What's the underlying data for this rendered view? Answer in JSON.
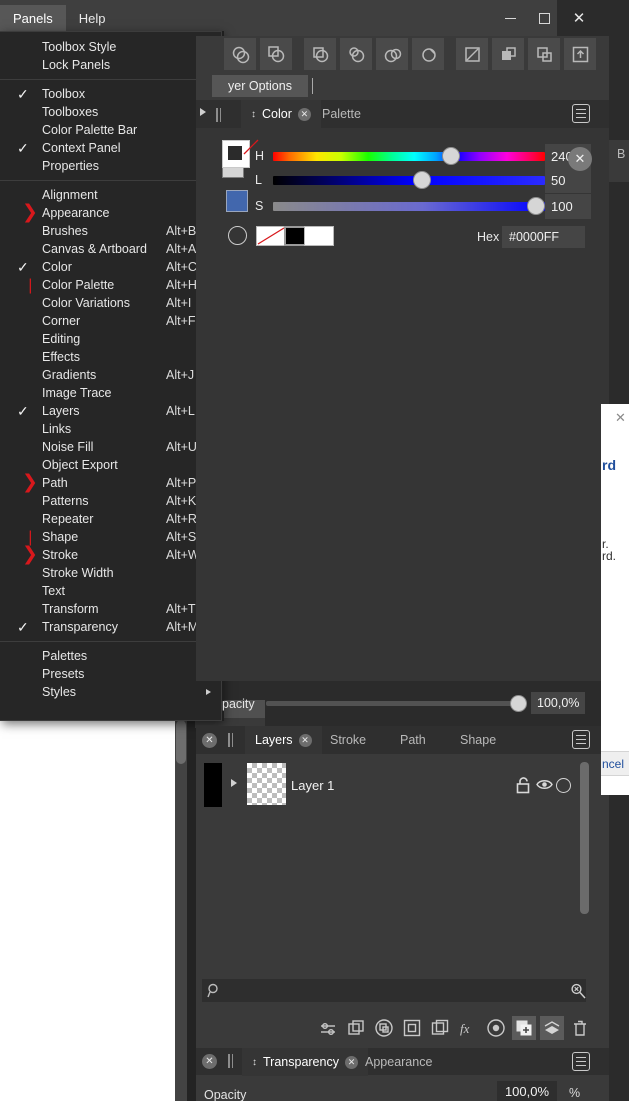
{
  "window": {
    "controls": [
      {
        "name": "minimize",
        "glyph": "minimize-icon"
      },
      {
        "name": "maximize",
        "glyph": "maximize-icon"
      },
      {
        "name": "close",
        "glyph": "close-icon",
        "label": "✕"
      }
    ]
  },
  "menubar": {
    "items": [
      {
        "label": "Panels",
        "active": true
      },
      {
        "label": "Help",
        "active": false
      }
    ]
  },
  "panels_menu": {
    "groups": [
      {
        "items": [
          {
            "label": "Toolbox Style",
            "shortcut": "",
            "submenu": true,
            "check": "",
            "redmark": ""
          },
          {
            "label": "Lock Panels",
            "shortcut": "",
            "submenu": true,
            "check": "",
            "redmark": ""
          }
        ]
      },
      {
        "items": [
          {
            "label": "Toolbox",
            "shortcut": "",
            "submenu": false,
            "check": "✓",
            "redmark": ""
          },
          {
            "label": "Toolboxes",
            "shortcut": "",
            "submenu": true,
            "check": "",
            "redmark": ""
          },
          {
            "label": "Color Palette Bar",
            "shortcut": "",
            "submenu": false,
            "check": "",
            "redmark": ""
          },
          {
            "label": "Context Panel",
            "shortcut": "",
            "submenu": false,
            "check": "✓",
            "redmark": ""
          },
          {
            "label": "Properties",
            "shortcut": "",
            "submenu": false,
            "check": "",
            "redmark": ""
          }
        ]
      },
      {
        "items": [
          {
            "label": "Alignment",
            "shortcut": "",
            "submenu": false,
            "check": "",
            "redmark": ""
          },
          {
            "label": "Appearance",
            "shortcut": "",
            "submenu": false,
            "check": "",
            "redmark": "❯"
          },
          {
            "label": "Brushes",
            "shortcut": "Alt+B",
            "submenu": false,
            "check": "",
            "redmark": ""
          },
          {
            "label": "Canvas & Artboard",
            "shortcut": "Alt+A",
            "submenu": false,
            "check": "",
            "redmark": ""
          },
          {
            "label": "Color",
            "shortcut": "Alt+C",
            "submenu": false,
            "check": "✓",
            "redmark": ""
          },
          {
            "label": "Color Palette",
            "shortcut": "Alt+H",
            "submenu": false,
            "check": "",
            "redmark": "❘"
          },
          {
            "label": "Color Variations",
            "shortcut": "Alt+I",
            "submenu": false,
            "check": "",
            "redmark": ""
          },
          {
            "label": "Corner",
            "shortcut": "Alt+F",
            "submenu": false,
            "check": "",
            "redmark": ""
          },
          {
            "label": "Editing",
            "shortcut": "",
            "submenu": true,
            "check": "",
            "redmark": ""
          },
          {
            "label": "Effects",
            "shortcut": "",
            "submenu": true,
            "check": "",
            "redmark": ""
          },
          {
            "label": "Gradients",
            "shortcut": "Alt+J",
            "submenu": false,
            "check": "",
            "redmark": ""
          },
          {
            "label": "Image Trace",
            "shortcut": "",
            "submenu": false,
            "check": "",
            "redmark": ""
          },
          {
            "label": "Layers",
            "shortcut": "Alt+L",
            "submenu": false,
            "check": "✓",
            "redmark": ""
          },
          {
            "label": "Links",
            "shortcut": "",
            "submenu": false,
            "check": "",
            "redmark": ""
          },
          {
            "label": "Noise Fill",
            "shortcut": "Alt+U",
            "submenu": false,
            "check": "",
            "redmark": ""
          },
          {
            "label": "Object Export",
            "shortcut": "",
            "submenu": false,
            "check": "",
            "redmark": ""
          },
          {
            "label": "Path",
            "shortcut": "Alt+P",
            "submenu": false,
            "check": "",
            "redmark": "❯"
          },
          {
            "label": "Patterns",
            "shortcut": "Alt+K",
            "submenu": false,
            "check": "",
            "redmark": ""
          },
          {
            "label": "Repeater",
            "shortcut": "Alt+R",
            "submenu": false,
            "check": "",
            "redmark": ""
          },
          {
            "label": "Shape",
            "shortcut": "Alt+S",
            "submenu": false,
            "check": "",
            "redmark": "❘"
          },
          {
            "label": "Stroke",
            "shortcut": "Alt+W",
            "submenu": false,
            "check": "",
            "redmark": "❯"
          },
          {
            "label": "Stroke Width",
            "shortcut": "",
            "submenu": false,
            "check": "",
            "redmark": ""
          },
          {
            "label": "Text",
            "shortcut": "",
            "submenu": true,
            "check": "",
            "redmark": ""
          },
          {
            "label": "Transform",
            "shortcut": "Alt+T",
            "submenu": false,
            "check": "",
            "redmark": ""
          },
          {
            "label": "Transparency",
            "shortcut": "Alt+M",
            "submenu": false,
            "check": "✓",
            "redmark": ""
          }
        ]
      },
      {
        "items": [
          {
            "label": "Palettes",
            "shortcut": "",
            "submenu": true,
            "check": "",
            "redmark": ""
          },
          {
            "label": "Presets",
            "shortcut": "",
            "submenu": true,
            "check": "",
            "redmark": ""
          },
          {
            "label": "Styles",
            "shortcut": "",
            "submenu": true,
            "check": "",
            "redmark": ""
          }
        ]
      }
    ]
  },
  "toolbar": {
    "buttons": [
      {
        "name": "unite-icon"
      },
      {
        "name": "subtract-icon"
      },
      {
        "name": "intersect-icon"
      },
      {
        "name": "exclude-icon"
      },
      {
        "name": "divide-icon"
      },
      {
        "name": "merge-icon"
      },
      {
        "name": "expand-stroke-icon"
      },
      {
        "name": "bring-forward-icon"
      },
      {
        "name": "send-backward-icon"
      },
      {
        "name": "export-icon"
      }
    ]
  },
  "layer_options_bar": {
    "tab_label": "yer Options"
  },
  "behind_panel": {
    "label": "B"
  },
  "color_panel": {
    "tabs": [
      {
        "label": "Color",
        "active": true,
        "closable": true
      },
      {
        "label": "Palette",
        "active": false,
        "closable": false
      }
    ],
    "model": "HLS",
    "sliders": [
      {
        "label": "H",
        "value": "240",
        "percent": 66.7
      },
      {
        "label": "L",
        "value": "50",
        "percent": 55.0
      },
      {
        "label": "S",
        "value": "100",
        "percent": 100.0
      }
    ],
    "hex_label": "Hex",
    "hex_value": "#0000FF",
    "active_color": "#0000FF",
    "swatch_blue": "#4267ad",
    "swatches": [
      {
        "name": "none-swatch",
        "color": "none"
      },
      {
        "name": "black-swatch",
        "color": "#000000",
        "selected": true
      },
      {
        "name": "white-swatch",
        "color": "#FFFFFF"
      }
    ],
    "opacity": {
      "label": "pacity",
      "value": "100,0%",
      "percent": 100
    }
  },
  "layers_panel": {
    "tabs": [
      {
        "label": "Layers",
        "active": true,
        "closable": true
      },
      {
        "label": "Stroke",
        "active": false,
        "closable": false
      },
      {
        "label": "Path",
        "active": false,
        "closable": false
      },
      {
        "label": "Shape",
        "active": false,
        "closable": false
      }
    ],
    "rows": [
      {
        "name": "Layer 1",
        "locked": false,
        "visible": true
      }
    ],
    "search_placeholder": "",
    "footer_buttons": [
      {
        "name": "layer-settings-icon"
      },
      {
        "name": "duplicate-layer-icon"
      },
      {
        "name": "mask-icon"
      },
      {
        "name": "insert-inside-icon"
      },
      {
        "name": "insert-outside-icon"
      },
      {
        "name": "fx-icon"
      },
      {
        "name": "adjustment-icon"
      },
      {
        "name": "add-layer-icon",
        "selected": true
      },
      {
        "name": "group-layers-icon",
        "selected": true
      },
      {
        "name": "delete-layer-icon"
      }
    ]
  },
  "transparency_panel": {
    "tabs": [
      {
        "label": "Transparency",
        "active": true,
        "closable": true
      },
      {
        "label": "Appearance",
        "active": false,
        "closable": false
      }
    ],
    "opacity_label": "Opacity",
    "opacity_value": "100,0%",
    "percent_symbol": "%"
  },
  "dialog_fragment": {
    "line1": "rd",
    "line2": "r.",
    "line3": "rd.",
    "cancel_label": "ncel",
    "close_glyph": "✕"
  },
  "colors": {
    "panel_bg": "#353535",
    "tabstrip_bg": "#2f2f2f",
    "menu_bg": "#262626",
    "accent_red": "#d8181c",
    "accent_blue": "#0000FF"
  }
}
